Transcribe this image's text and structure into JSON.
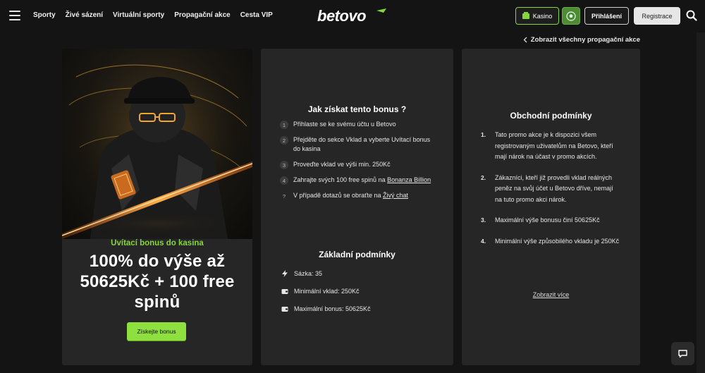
{
  "nav": {
    "items": [
      "Sporty",
      "Živé sázení",
      "Virtuální sporty",
      "Propagační akce",
      "Cesta VIP"
    ]
  },
  "brand": {
    "logo_text": "betovo",
    "accent": "#86d63b"
  },
  "header": {
    "kasino_label": "Kasino",
    "login_label": "Přihlášení",
    "register_label": "Registrace"
  },
  "back_link": "Zobrazit všechny propagační akce",
  "promo": {
    "subtitle": "Uvítací bonus do kasina",
    "title": "100% do výše až 50625Kč + 100 free spinů",
    "cta": "Získejte bonus"
  },
  "how_to": {
    "heading": "Jak získat tento bonus ?",
    "steps": [
      {
        "num": "1",
        "text": "Přihlaste se ke svému účtu u Betovo",
        "link": ""
      },
      {
        "num": "2",
        "text": "Přejděte do sekce Vklad a vyberte Uvítací bonus do kasina",
        "link": ""
      },
      {
        "num": "3",
        "text": "Proveďte vklad ve výši min. 250Kč",
        "link": ""
      },
      {
        "num": "4",
        "text": "Zahrajte svých 100 free spinů na ",
        "link": "Bonanza Billion"
      },
      {
        "num": "?",
        "text": "V případě dotazů se obraťte na ",
        "link": "Živý chat"
      }
    ]
  },
  "basic": {
    "heading": "Základní podmínky",
    "items": [
      {
        "icon": "bolt-icon",
        "text": "Sázka: 35"
      },
      {
        "icon": "wallet-icon",
        "text": "Minimální vklad: 250Kč"
      },
      {
        "icon": "wallet-icon",
        "text": "Maximální bonus: 50625Kč"
      }
    ]
  },
  "terms": {
    "heading": "Obchodní podmínky",
    "items": [
      {
        "num": "1.",
        "text": "Tato promo akce je k dispozici všem registrovaným uživatelům na Betovo, kteří mají nárok na účast v promo akcích."
      },
      {
        "num": "2.",
        "text": "Zákazníci, kteří již provedli vklad reálných peněz na svůj účet u Betovo dříve, nemají na tuto promo akci nárok."
      },
      {
        "num": "3.",
        "text": "Maximální výše bonusu činí 50625Kč"
      },
      {
        "num": "4.",
        "text": "Minimální výše způsobilého vkladu je 250Kč"
      }
    ],
    "show_more": "Zobrazit více"
  }
}
